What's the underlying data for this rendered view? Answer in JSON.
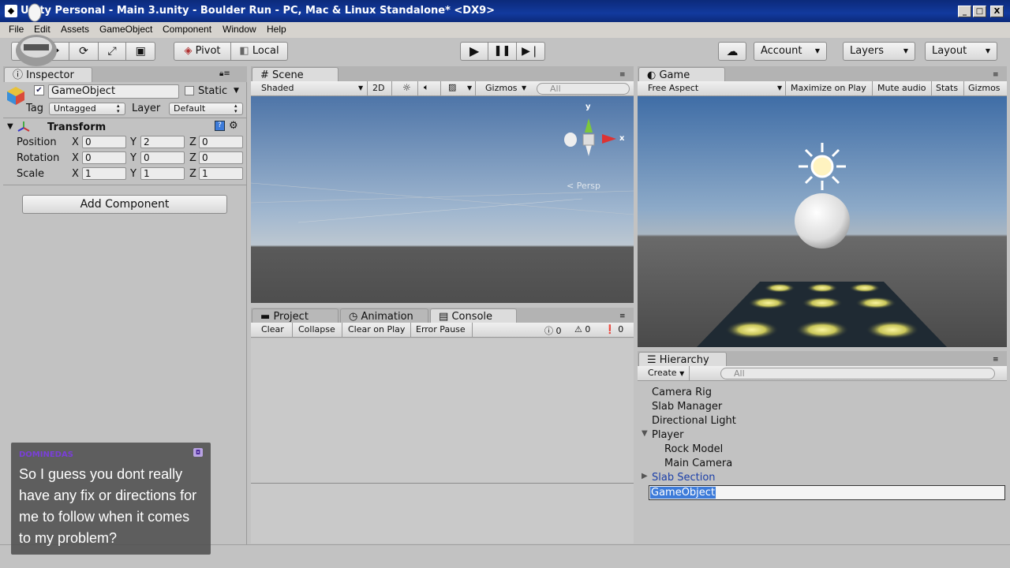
{
  "window": {
    "title": "Unity Personal - Main 3.unity - Boulder Run - PC, Mac & Linux Standalone* <DX9>",
    "app_icon": "unity-icon",
    "controls": [
      "_",
      "□",
      "X"
    ]
  },
  "menubar": {
    "items": [
      "File",
      "Edit",
      "Assets",
      "GameObject",
      "Component",
      "Window",
      "Help"
    ]
  },
  "toolbar": {
    "transform_tools": [
      "hand-tool",
      "move-tool",
      "rotate-tool",
      "scale-tool",
      "rect-tool"
    ],
    "pivot_label": "Pivot",
    "local_label": "Local",
    "play_icons": {
      "play": "▶",
      "pause": "❚❚",
      "step": "▶❘"
    },
    "account_label": "Account",
    "layers_label": "Layers",
    "layout_label": "Layout"
  },
  "inspector": {
    "tab": "Inspector",
    "object_name": "GameObject",
    "static_label": "Static",
    "tag_label": "Tag",
    "tag_value": "Untagged",
    "layer_label": "Layer",
    "layer_value": "Default",
    "component_title": "Transform",
    "rows": [
      {
        "label": "Position",
        "x": "0",
        "y": "2",
        "z": "0"
      },
      {
        "label": "Rotation",
        "x": "0",
        "y": "0",
        "z": "0"
      },
      {
        "label": "Scale",
        "x": "1",
        "y": "1",
        "z": "1"
      }
    ],
    "axis": {
      "x": "X",
      "y": "Y",
      "z": "Z"
    },
    "add_component": "Add Component"
  },
  "scene": {
    "tab": "Scene",
    "shading": "Shaded",
    "mode_2d": "2D",
    "gizmos": "Gizmos",
    "search_placeholder": "All",
    "persp_label": "Persp",
    "gizmo_axes": {
      "x": "x",
      "y": "y"
    }
  },
  "bottom": {
    "tabs": [
      "Project",
      "Animation",
      "Console"
    ],
    "buttons": [
      "Clear",
      "Collapse",
      "Clear on Play",
      "Error Pause"
    ],
    "counts": {
      "errors": "0",
      "warnings": "0",
      "messages": "0"
    }
  },
  "game": {
    "tab": "Game",
    "aspect": "Free Aspect",
    "buttons": [
      "Maximize on Play",
      "Mute audio",
      "Stats",
      "Gizmos"
    ]
  },
  "hierarchy": {
    "tab": "Hierarchy",
    "create_label": "Create",
    "search_placeholder": "All",
    "items": [
      "Camera Rig",
      "Slab Manager",
      "Directional Light",
      "Player",
      "Rock Model",
      "Main Camera",
      "Slab Section"
    ],
    "rename_value": "GameObject"
  },
  "chat": {
    "username": "DOMINEDAS",
    "message": "So I guess you dont really have any fix or directions for me to follow when it comes to my problem?"
  },
  "colors": {
    "titlebar": "#123a9e",
    "selection": "#3d7bd9",
    "prefab_blue": "#1b3fa8"
  }
}
